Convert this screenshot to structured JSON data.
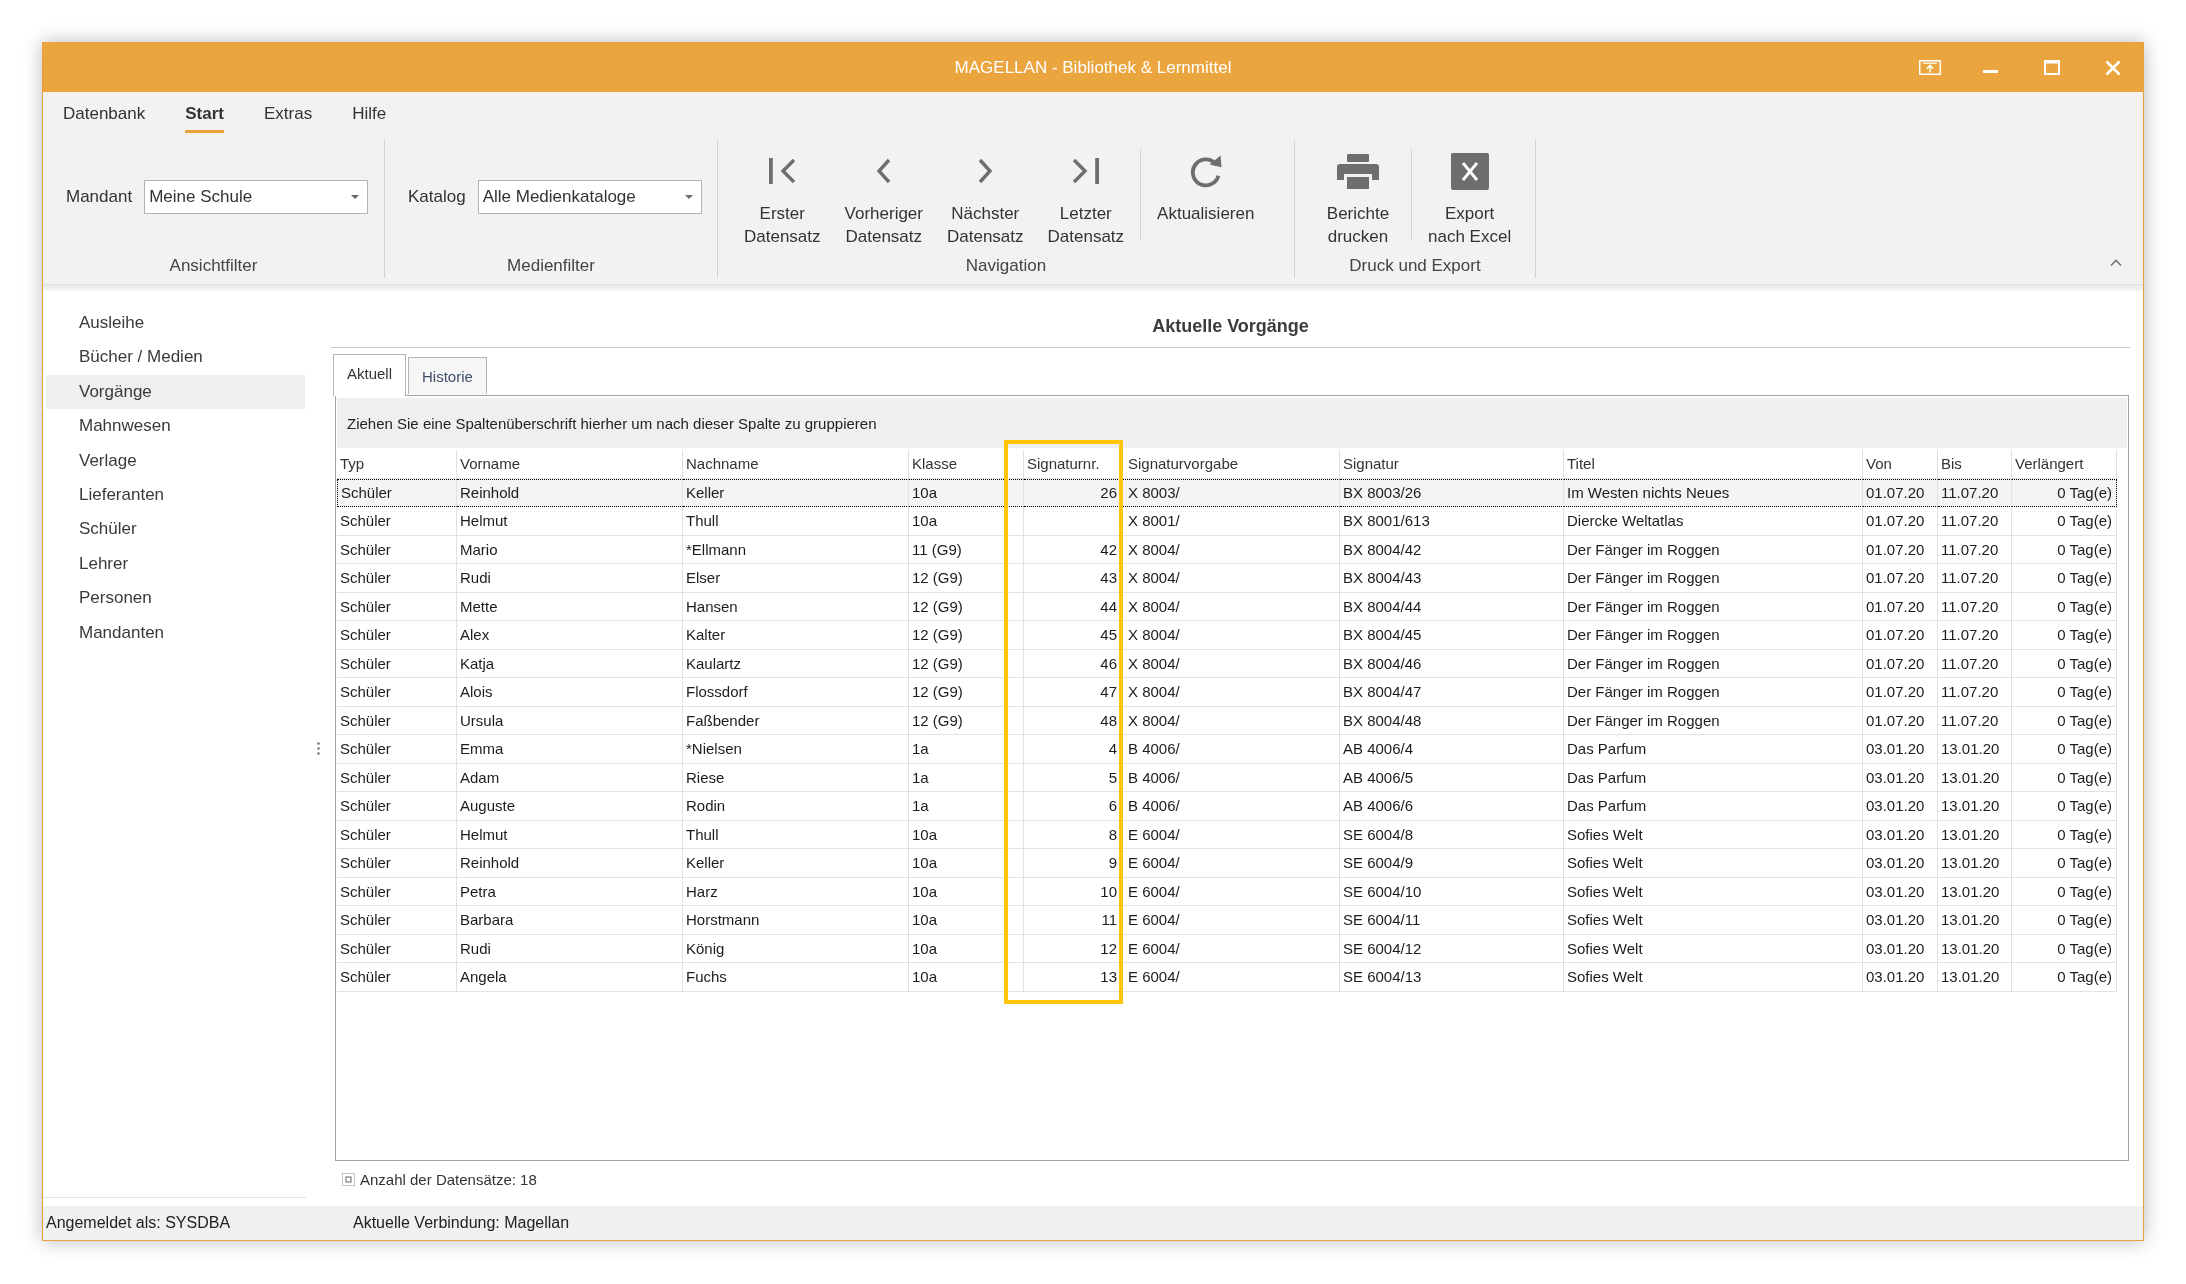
{
  "window": {
    "title": "MAGELLAN - Bibliothek & Lernmittel"
  },
  "menu": [
    {
      "label": "Datenbank",
      "selected": false
    },
    {
      "label": "Start",
      "selected": true
    },
    {
      "label": "Extras",
      "selected": false
    },
    {
      "label": "Hilfe",
      "selected": false
    }
  ],
  "ribbon": {
    "groups": [
      {
        "kind": "filter",
        "label": "Ansichtfilter",
        "field": {
          "label": "Mandant",
          "value": "Meine Schule"
        }
      },
      {
        "kind": "filter",
        "label": "Medienfilter",
        "field": {
          "label": "Katalog",
          "value": "Alle Medienkataloge"
        }
      },
      {
        "kind": "buttons",
        "label": "Navigation",
        "sections": [
          [
            "Erster Datensatz",
            "Vorheriger Datensatz",
            "Nächster Datensatz",
            "Letzter Datensatz"
          ],
          [
            "Aktualisieren"
          ]
        ]
      },
      {
        "kind": "buttons",
        "label": "Druck und Export",
        "sections": [
          [
            "Berichte drucken"
          ],
          [
            "Export nach Excel"
          ]
        ]
      }
    ]
  },
  "sidebar": {
    "items": [
      {
        "label": "Ausleihe",
        "selected": false
      },
      {
        "label": "Bücher / Medien",
        "selected": false
      },
      {
        "label": "Vorgänge",
        "selected": true
      },
      {
        "label": "Mahnwesen",
        "selected": false
      },
      {
        "label": "Verlage",
        "selected": false
      },
      {
        "label": "Lieferanten",
        "selected": false
      },
      {
        "label": "Schüler",
        "selected": false
      },
      {
        "label": "Lehrer",
        "selected": false
      },
      {
        "label": "Personen",
        "selected": false
      },
      {
        "label": "Mandanten",
        "selected": false
      }
    ]
  },
  "content": {
    "title": "Aktuelle Vorgänge",
    "tabs": [
      {
        "label": "Aktuell",
        "selected": true
      },
      {
        "label": "Historie",
        "selected": false
      }
    ],
    "grid": {
      "group_hint": "Ziehen Sie eine Spaltenüberschrift hierher um nach dieser Spalte zu gruppieren",
      "columns": [
        {
          "label": "Typ",
          "highlighted": false
        },
        {
          "label": "Vorname",
          "highlighted": false
        },
        {
          "label": "Nachname",
          "highlighted": false
        },
        {
          "label": "Klasse",
          "highlighted": false
        },
        {
          "label": "Signaturnr.",
          "highlighted": true
        },
        {
          "label": "Signaturvorgabe",
          "highlighted": false
        },
        {
          "label": "Signatur",
          "highlighted": false
        },
        {
          "label": "Titel",
          "highlighted": false
        },
        {
          "label": "Von",
          "highlighted": false
        },
        {
          "label": "Bis",
          "highlighted": false
        },
        {
          "label": "Verlängert",
          "highlighted": false
        }
      ],
      "rows": [
        {
          "focused": true,
          "type": "Schüler",
          "first_name": "Reinhold",
          "last_name": "Keller",
          "class": "10a",
          "signature_no": "26",
          "signature_template": "X 8003/",
          "signature": "BX 8003/26",
          "title": "Im Westen nichts Neues",
          "from": "01.07.20",
          "until": "11.07.20",
          "extended": "0 Tag(e)"
        },
        {
          "focused": false,
          "type": "Schüler",
          "first_name": "Helmut",
          "last_name": "Thull",
          "class": "10a",
          "signature_template": "X 8001/",
          "signature": "BX 8001/613",
          "title": "Diercke Weltatlas",
          "from": "01.07.20",
          "until": "11.07.20",
          "extended": "0 Tag(e)"
        },
        {
          "focused": false,
          "type": "Schüler",
          "first_name": "Mario",
          "last_name": "*Ellmann",
          "class": "11 (G9)",
          "signature_no": "42",
          "signature_template": "X 8004/",
          "signature": "BX 8004/42",
          "title": "Der Fänger im Roggen",
          "from": "01.07.20",
          "until": "11.07.20",
          "extended": "0 Tag(e)"
        },
        {
          "focused": false,
          "type": "Schüler",
          "first_name": "Rudi",
          "last_name": "Elser",
          "class": "12 (G9)",
          "signature_no": "43",
          "signature_template": "X 8004/",
          "signature": "BX 8004/43",
          "title": "Der Fänger im Roggen",
          "from": "01.07.20",
          "until": "11.07.20",
          "extended": "0 Tag(e)"
        },
        {
          "focused": false,
          "type": "Schüler",
          "first_name": "Mette",
          "last_name": "Hansen",
          "class": "12 (G9)",
          "signature_no": "44",
          "signature_template": "X 8004/",
          "signature": "BX 8004/44",
          "title": "Der Fänger im Roggen",
          "from": "01.07.20",
          "until": "11.07.20",
          "extended": "0 Tag(e)"
        },
        {
          "focused": false,
          "type": "Schüler",
          "first_name": "Alex",
          "last_name": "Kalter",
          "class": "12 (G9)",
          "signature_no": "45",
          "signature_template": "X 8004/",
          "signature": "BX 8004/45",
          "title": "Der Fänger im Roggen",
          "from": "01.07.20",
          "until": "11.07.20",
          "extended": "0 Tag(e)"
        },
        {
          "focused": false,
          "type": "Schüler",
          "first_name": "Katja",
          "last_name": "Kaulartz",
          "class": "12 (G9)",
          "signature_no": "46",
          "signature_template": "X 8004/",
          "signature": "BX 8004/46",
          "title": "Der Fänger im Roggen",
          "from": "01.07.20",
          "until": "11.07.20",
          "extended": "0 Tag(e)"
        },
        {
          "focused": false,
          "type": "Schüler",
          "first_name": "Alois",
          "last_name": "Flossdorf",
          "class": "12 (G9)",
          "signature_no": "47",
          "signature_template": "X 8004/",
          "signature": "BX 8004/47",
          "title": "Der Fänger im Roggen",
          "from": "01.07.20",
          "until": "11.07.20",
          "extended": "0 Tag(e)"
        },
        {
          "focused": false,
          "type": "Schüler",
          "first_name": "Ursula",
          "last_name": "Faßbender",
          "class": "12 (G9)",
          "signature_no": "48",
          "signature_template": "X 8004/",
          "signature": "BX 8004/48",
          "title": "Der Fänger im Roggen",
          "from": "01.07.20",
          "until": "11.07.20",
          "extended": "0 Tag(e)"
        },
        {
          "focused": false,
          "type": "Schüler",
          "first_name": "Emma",
          "last_name": "*Nielsen",
          "class": "1a",
          "signature_no": "4",
          "signature_template": "B 4006/",
          "signature": "AB 4006/4",
          "title": "Das Parfum",
          "from": "03.01.20",
          "until": "13.01.20",
          "extended": "0 Tag(e)"
        },
        {
          "focused": false,
          "type": "Schüler",
          "first_name": "Adam",
          "last_name": "Riese",
          "class": "1a",
          "signature_no": "5",
          "signature_template": "B 4006/",
          "signature": "AB 4006/5",
          "title": "Das Parfum",
          "from": "03.01.20",
          "until": "13.01.20",
          "extended": "0 Tag(e)"
        },
        {
          "focused": false,
          "type": "Schüler",
          "first_name": "Auguste",
          "last_name": "Rodin",
          "class": "1a",
          "signature_no": "6",
          "signature_template": "B 4006/",
          "signature": "AB 4006/6",
          "title": "Das Parfum",
          "from": "03.01.20",
          "until": "13.01.20",
          "extended": "0 Tag(e)"
        },
        {
          "focused": false,
          "type": "Schüler",
          "first_name": "Helmut",
          "last_name": "Thull",
          "class": "10a",
          "signature_no": "8",
          "signature_template": "E 6004/",
          "signature": "SE 6004/8",
          "title": "Sofies Welt",
          "from": "03.01.20",
          "until": "13.01.20",
          "extended": "0 Tag(e)"
        },
        {
          "focused": false,
          "type": "Schüler",
          "first_name": "Reinhold",
          "last_name": "Keller",
          "class": "10a",
          "signature_no": "9",
          "signature_template": "E 6004/",
          "signature": "SE 6004/9",
          "title": "Sofies Welt",
          "from": "03.01.20",
          "until": "13.01.20",
          "extended": "0 Tag(e)"
        },
        {
          "focused": false,
          "type": "Schüler",
          "first_name": "Petra",
          "last_name": "Harz",
          "class": "10a",
          "signature_no": "10",
          "signature_template": "E 6004/",
          "signature": "SE 6004/10",
          "title": "Sofies Welt",
          "from": "03.01.20",
          "until": "13.01.20",
          "extended": "0 Tag(e)"
        },
        {
          "focused": false,
          "type": "Schüler",
          "first_name": "Barbara",
          "last_name": "Horstmann",
          "class": "10a",
          "signature_no": "11",
          "signature_template": "E 6004/",
          "signature": "SE 6004/11",
          "title": "Sofies Welt",
          "from": "03.01.20",
          "until": "13.01.20",
          "extended": "0 Tag(e)"
        },
        {
          "focused": false,
          "type": "Schüler",
          "first_name": "Rudi",
          "last_name": "König",
          "class": "10a",
          "signature_no": "12",
          "signature_template": "E 6004/",
          "signature": "SE 6004/12",
          "title": "Sofies Welt",
          "from": "03.01.20",
          "until": "13.01.20",
          "extended": "0 Tag(e)"
        },
        {
          "focused": false,
          "type": "Schüler",
          "first_name": "Angela",
          "last_name": "Fuchs",
          "class": "10a",
          "signature_no": "13",
          "signature_template": "E 6004/",
          "signature": "SE 6004/13",
          "title": "Sofies Welt",
          "from": "03.01.20",
          "until": "13.01.20",
          "extended": "0 Tag(e)"
        }
      ]
    },
    "record_count": "Anzahl der Datensätze: 18"
  },
  "status_bar": {
    "items": [
      "Angemeldet als: SYSDBA",
      "Aktuelle Verbindung: Magellan"
    ]
  }
}
